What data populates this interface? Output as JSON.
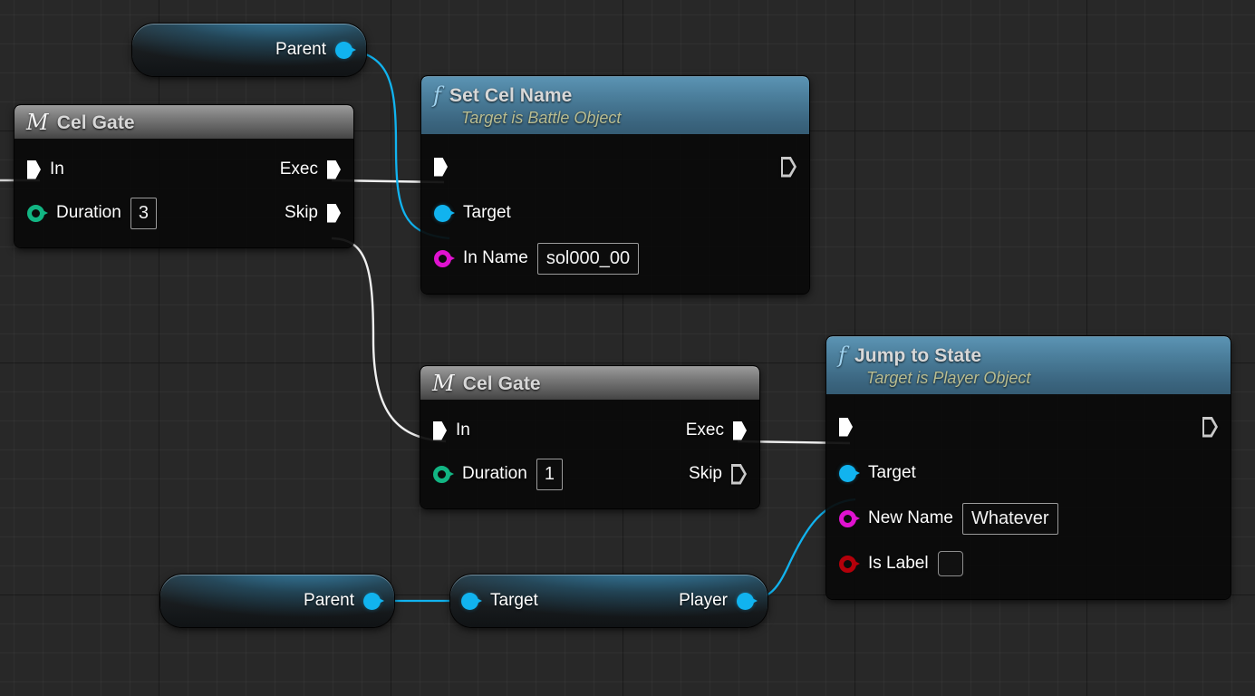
{
  "graph": {
    "background_color": "#282828",
    "grid_minor_color": "#343434",
    "grid_major_color": "#1a1a1a"
  },
  "colors": {
    "exec_wire": "#f0f0f0",
    "object_wire": "#11b3ef",
    "object_pin": "#11b3ef",
    "float_pin": "#12b583",
    "name_pin": "#e012d0",
    "bool_pin": "#b4000a",
    "function_header": "#3c6781",
    "macro_header": "#808080",
    "subtitle_text": "#b9bd91",
    "node_body": "#0a0a0a"
  },
  "nodes": [
    {
      "id": "parent-top",
      "kind": "pill",
      "output_label": "Parent",
      "output_pin": "object-pin"
    },
    {
      "id": "cel-gate-1",
      "kind": "macro",
      "icon": "macro-m-icon",
      "title": "Cel Gate",
      "inputs": [
        {
          "label": "In",
          "pin": "exec-pin"
        },
        {
          "label": "Duration",
          "pin": "float-pin",
          "value": "3"
        }
      ],
      "outputs": [
        {
          "label": "Exec",
          "pin": "exec-pin"
        },
        {
          "label": "Skip",
          "pin": "exec-pin"
        }
      ]
    },
    {
      "id": "set-cel-name",
      "kind": "function",
      "icon": "function-f-icon",
      "title": "Set Cel Name",
      "subtitle": "Target is Battle Object",
      "inputs": [
        {
          "label": "",
          "pin": "exec-pin"
        },
        {
          "label": "Target",
          "pin": "object-pin"
        },
        {
          "label": "In Name",
          "pin": "name-pin",
          "value": "sol000_00"
        }
      ],
      "outputs": [
        {
          "label": "",
          "pin": "exec-pin-hollow"
        }
      ]
    },
    {
      "id": "cel-gate-2",
      "kind": "macro",
      "icon": "macro-m-icon",
      "title": "Cel Gate",
      "inputs": [
        {
          "label": "In",
          "pin": "exec-pin"
        },
        {
          "label": "Duration",
          "pin": "float-pin",
          "value": "1"
        }
      ],
      "outputs": [
        {
          "label": "Exec",
          "pin": "exec-pin"
        },
        {
          "label": "Skip",
          "pin": "exec-pin-hollow"
        }
      ]
    },
    {
      "id": "jump-to-state",
      "kind": "function",
      "icon": "function-f-icon",
      "title": "Jump to State",
      "subtitle": "Target is Player Object",
      "inputs": [
        {
          "label": "",
          "pin": "exec-pin"
        },
        {
          "label": "Target",
          "pin": "object-pin"
        },
        {
          "label": "New Name",
          "pin": "name-pin",
          "value": "Whatever"
        },
        {
          "label": "Is Label",
          "pin": "bool-pin",
          "value": "",
          "checked": false
        }
      ],
      "outputs": [
        {
          "label": "",
          "pin": "exec-pin-hollow"
        }
      ]
    },
    {
      "id": "parent-bottom",
      "kind": "pill",
      "output_label": "Parent",
      "output_pin": "object-pin"
    },
    {
      "id": "target-player",
      "kind": "pill",
      "input_label": "Target",
      "output_label": "Player",
      "input_pin": "object-pin",
      "output_pin": "object-pin"
    }
  ],
  "labels": {
    "parent_top": "Parent",
    "cel_gate_1": {
      "title": "Cel Gate",
      "icon": "M",
      "in": "In",
      "exec": "Exec",
      "duration": "Duration",
      "duration_value": "3",
      "skip": "Skip"
    },
    "set_cel_name": {
      "title": "Set Cel Name",
      "icon": "f",
      "subtitle": "Target is Battle Object",
      "target": "Target",
      "in_name": "In Name",
      "in_name_value": "sol000_00"
    },
    "cel_gate_2": {
      "title": "Cel Gate",
      "icon": "M",
      "in": "In",
      "exec": "Exec",
      "duration": "Duration",
      "duration_value": "1",
      "skip": "Skip"
    },
    "jump_to_state": {
      "title": "Jump to State",
      "icon": "f",
      "subtitle": "Target is Player Object",
      "target": "Target",
      "new_name": "New Name",
      "new_name_value": "Whatever",
      "is_label": "Is Label"
    },
    "parent_bottom": "Parent",
    "target_player": {
      "target": "Target",
      "player": "Player"
    }
  }
}
